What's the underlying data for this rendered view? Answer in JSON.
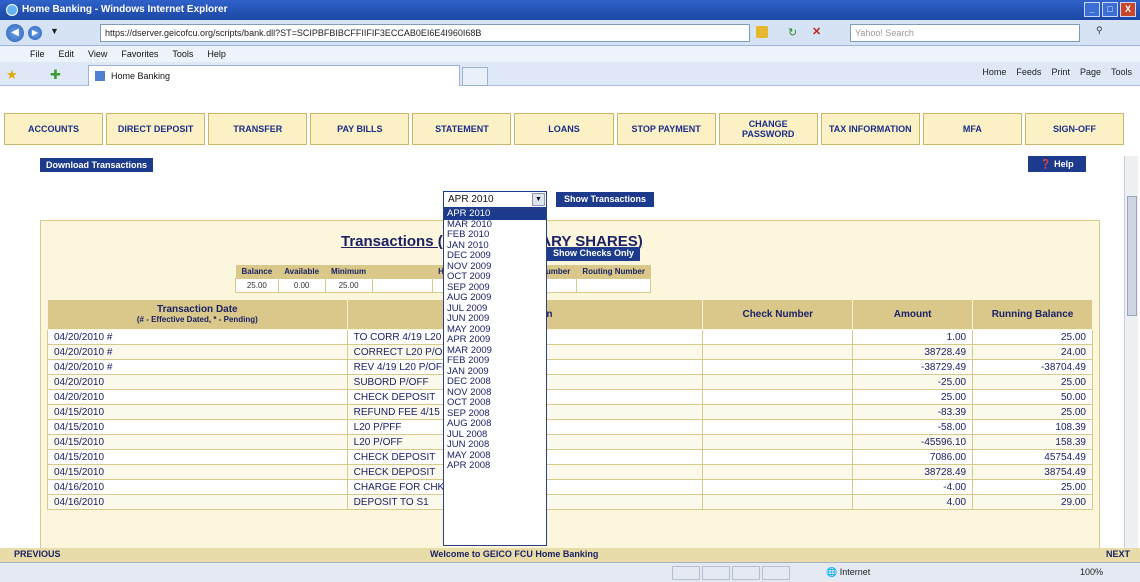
{
  "window": {
    "title": "Home Banking - Windows Internet Explorer",
    "controls": [
      "_",
      "□",
      "X"
    ]
  },
  "address": {
    "url": "https://dserver.geicofcu.org/scripts/bank.dll?ST=SCIPBFBIBCFFIIFIF3ECCAB0EI6E4I960I68B",
    "search_placeholder": "Yahoo! Search"
  },
  "menu": [
    "File",
    "Edit",
    "View",
    "Favorites",
    "Tools",
    "Help"
  ],
  "tab": {
    "label": "Home Banking"
  },
  "ie_tools": [
    "Home",
    "Feeds",
    "Print",
    "Page",
    "Tools"
  ],
  "nav": [
    "ACCOUNTS",
    "DIRECT DEPOSIT",
    "TRANSFER",
    "PAY BILLS",
    "STATEMENT",
    "LOANS",
    "STOP PAYMENT",
    "CHANGE PASSWORD",
    "TAX INFORMATION",
    "MFA",
    "SIGN-OFF"
  ],
  "download_label": "Download Transactions",
  "help_label": "Help",
  "month_select": {
    "value": "APR 2010"
  },
  "show_transactions_label": "Show Transactions",
  "dropdown_months": [
    "APR 2010",
    "MAR 2010",
    "FEB 2010",
    "JAN 2010",
    "DEC 2009",
    "NOV 2009",
    "OCT 2009",
    "SEP 2009",
    "AUG 2009",
    "JUL 2009",
    "JUN 2009",
    "MAY 2009",
    "APR 2009",
    "MAR 2009",
    "FEB 2009",
    "JAN 2009",
    "DEC 2008",
    "NOV 2008",
    "OCT 2008",
    "SEP 2008",
    "AUG 2008",
    "JUL 2008",
    "JUN 2008",
    "MAY 2008",
    "APR 2008"
  ],
  "panel": {
    "title": "Transactions (011 S1 - PRIMARY SHARES)",
    "show_checks_label": "Show Checks Only",
    "balance_headers": [
      "Balance",
      "Available",
      "Minimum",
      "",
      "Hold Amount",
      "Check CU Number",
      "Routing Number"
    ],
    "balance_values": [
      "25.00",
      "0.00",
      "25.00",
      "",
      "0.00",
      "",
      ""
    ]
  },
  "table": {
    "headers": {
      "date": "Transaction Date",
      "date_note": "(# - Effective Dated, * - Pending)",
      "description": "Description",
      "check": "Check Number",
      "amount": "Amount",
      "running": "Running Balance"
    },
    "rows": [
      {
        "date": "04/20/2010 #",
        "desc": "TO CORR 4/19 L20 P/OF",
        "check": "",
        "amount": "1.00",
        "running": "25.00"
      },
      {
        "date": "04/20/2010 #",
        "desc": "CORRECT L20 P/OFF AMT",
        "check": "",
        "amount": "38728.49",
        "running": "24.00"
      },
      {
        "date": "04/20/2010 #",
        "desc": "REV 4/19 L20 P/OFF",
        "check": "",
        "amount": "-38729.49",
        "running": "-38704.49"
      },
      {
        "date": "04/20/2010",
        "desc": "SUBORD P/OFF",
        "check": "",
        "amount": "-25.00",
        "running": "25.00"
      },
      {
        "date": "04/20/2010",
        "desc": "CHECK DEPOSIT",
        "check": "",
        "amount": "25.00",
        "running": "50.00"
      },
      {
        "date": "04/15/2010",
        "desc": "REFUND FEE 4/15 CR/20-SU",
        "check": "",
        "amount": "-83.39",
        "running": "25.00"
      },
      {
        "date": "04/15/2010",
        "desc": "L20 P/PFF",
        "check": "",
        "amount": "-58.00",
        "running": "108.39"
      },
      {
        "date": "04/15/2010",
        "desc": "L20 P/OFF",
        "check": "",
        "amount": "-45596.10",
        "running": "158.39"
      },
      {
        "date": "04/15/2010",
        "desc": "CHECK DEPOSIT",
        "check": "",
        "amount": "7086.00",
        "running": "45754.49"
      },
      {
        "date": "04/15/2010",
        "desc": "CHECK DEPOSIT",
        "check": "",
        "amount": "38728.49",
        "running": "38754.49"
      },
      {
        "date": "04/16/2010",
        "desc": "CHARGE FOR CHK FEE",
        "check": "",
        "amount": "-4.00",
        "running": "25.00"
      },
      {
        "date": "04/16/2010",
        "desc": "DEPOSIT TO S1",
        "check": "",
        "amount": "4.00",
        "running": "29.00"
      }
    ]
  },
  "pagenav": {
    "prev": "PREVIOUS",
    "welcome": "Welcome to GEICO FCU Home Banking",
    "next": "NEXT"
  },
  "status": {
    "zone": "Internet",
    "zoom": "100%"
  }
}
